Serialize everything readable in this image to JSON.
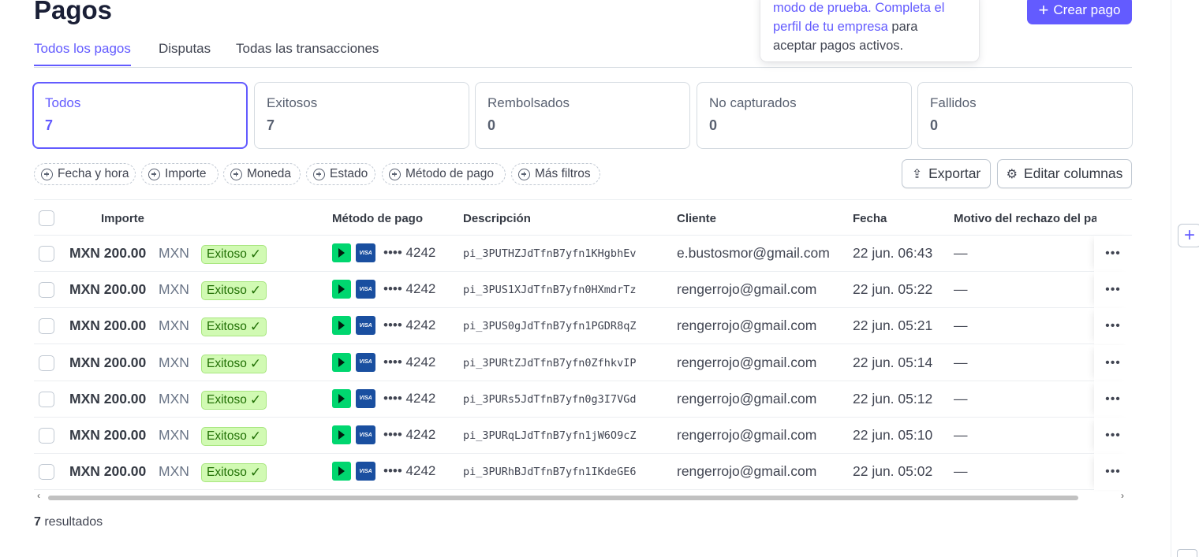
{
  "page": {
    "title": "Pagos"
  },
  "tabs": [
    {
      "label": "Todos los pagos",
      "active": true
    },
    {
      "label": "Disputas",
      "active": false
    },
    {
      "label": "Todas las transacciones",
      "active": false
    }
  ],
  "notice": {
    "line1_link": "modo de prueba. Completa el",
    "line2_link": "perfil de tu empresa",
    "line2_rest": " para",
    "line3": "aceptar pagos activos."
  },
  "create_button": {
    "label": "Crear pago"
  },
  "status_cards": [
    {
      "label": "Todos",
      "count": "7"
    },
    {
      "label": "Exitosos",
      "count": "7"
    },
    {
      "label": "Rembolsados",
      "count": "0"
    },
    {
      "label": "No capturados",
      "count": "0"
    },
    {
      "label": "Fallidos",
      "count": "0"
    }
  ],
  "filters": [
    {
      "label": "Fecha y hora"
    },
    {
      "label": "Importe"
    },
    {
      "label": "Moneda"
    },
    {
      "label": "Estado"
    },
    {
      "label": "Método de pago"
    },
    {
      "label": "Más filtros"
    }
  ],
  "actions": {
    "export_label": "Exportar",
    "edit_columns_label": "Editar columnas"
  },
  "table": {
    "headers": {
      "amount": "Importe",
      "payment_method": "Método de pago",
      "description": "Descripción",
      "customer": "Cliente",
      "date": "Fecha",
      "decline_reason": "Motivo del rechazo del pago"
    },
    "rows": [
      {
        "amount": "MXN 200.00",
        "currency": "MXN",
        "status": "Exitoso",
        "last4": "•••• 4242",
        "description": "pi_3PUTHZJdTfnB7yfn1KHgbhEv",
        "customer": "e.bustosmor@gmail.com",
        "date": "22 jun. 06:43",
        "decline": "—"
      },
      {
        "amount": "MXN 200.00",
        "currency": "MXN",
        "status": "Exitoso",
        "last4": "•••• 4242",
        "description": "pi_3PUS1XJdTfnB7yfn0HXmdrTz",
        "customer": "rengerrojo@gmail.com",
        "date": "22 jun. 05:22",
        "decline": "—"
      },
      {
        "amount": "MXN 200.00",
        "currency": "MXN",
        "status": "Exitoso",
        "last4": "•••• 4242",
        "description": "pi_3PUS0gJdTfnB7yfn1PGDR8qZ",
        "customer": "rengerrojo@gmail.com",
        "date": "22 jun. 05:21",
        "decline": "—"
      },
      {
        "amount": "MXN 200.00",
        "currency": "MXN",
        "status": "Exitoso",
        "last4": "•••• 4242",
        "description": "pi_3PURtZJdTfnB7yfn0ZfhkvIP",
        "customer": "rengerrojo@gmail.com",
        "date": "22 jun. 05:14",
        "decline": "—"
      },
      {
        "amount": "MXN 200.00",
        "currency": "MXN",
        "status": "Exitoso",
        "last4": "•••• 4242",
        "description": "pi_3PURs5JdTfnB7yfn0g3I7VGd",
        "customer": "rengerrojo@gmail.com",
        "date": "22 jun. 05:12",
        "decline": "—"
      },
      {
        "amount": "MXN 200.00",
        "currency": "MXN",
        "status": "Exitoso",
        "last4": "•••• 4242",
        "description": "pi_3PURqLJdTfnB7yfn1jW6O9cZ",
        "customer": "rengerrojo@gmail.com",
        "date": "22 jun. 05:10",
        "decline": "—"
      },
      {
        "amount": "MXN 200.00",
        "currency": "MXN",
        "status": "Exitoso",
        "last4": "•••• 4242",
        "description": "pi_3PURhBJdTfnB7yfn1IKdeGE6",
        "customer": "rengerrojo@gmail.com",
        "date": "22 jun. 05:02",
        "decline": "—"
      }
    ]
  },
  "results": {
    "count": "7",
    "suffix": " resultados"
  },
  "colors": {
    "accent": "#635bff",
    "success_bg": "#d1fab3",
    "success_text": "#217005",
    "link_green": "#00d66f",
    "visa_blue": "#1a4fa0"
  },
  "icons": {
    "plus": "plus-icon",
    "export": "export-icon",
    "settings": "gear-icon",
    "check": "check-icon",
    "more": "more-icon",
    "link": "link-pay-icon",
    "visa": "visa-icon"
  }
}
